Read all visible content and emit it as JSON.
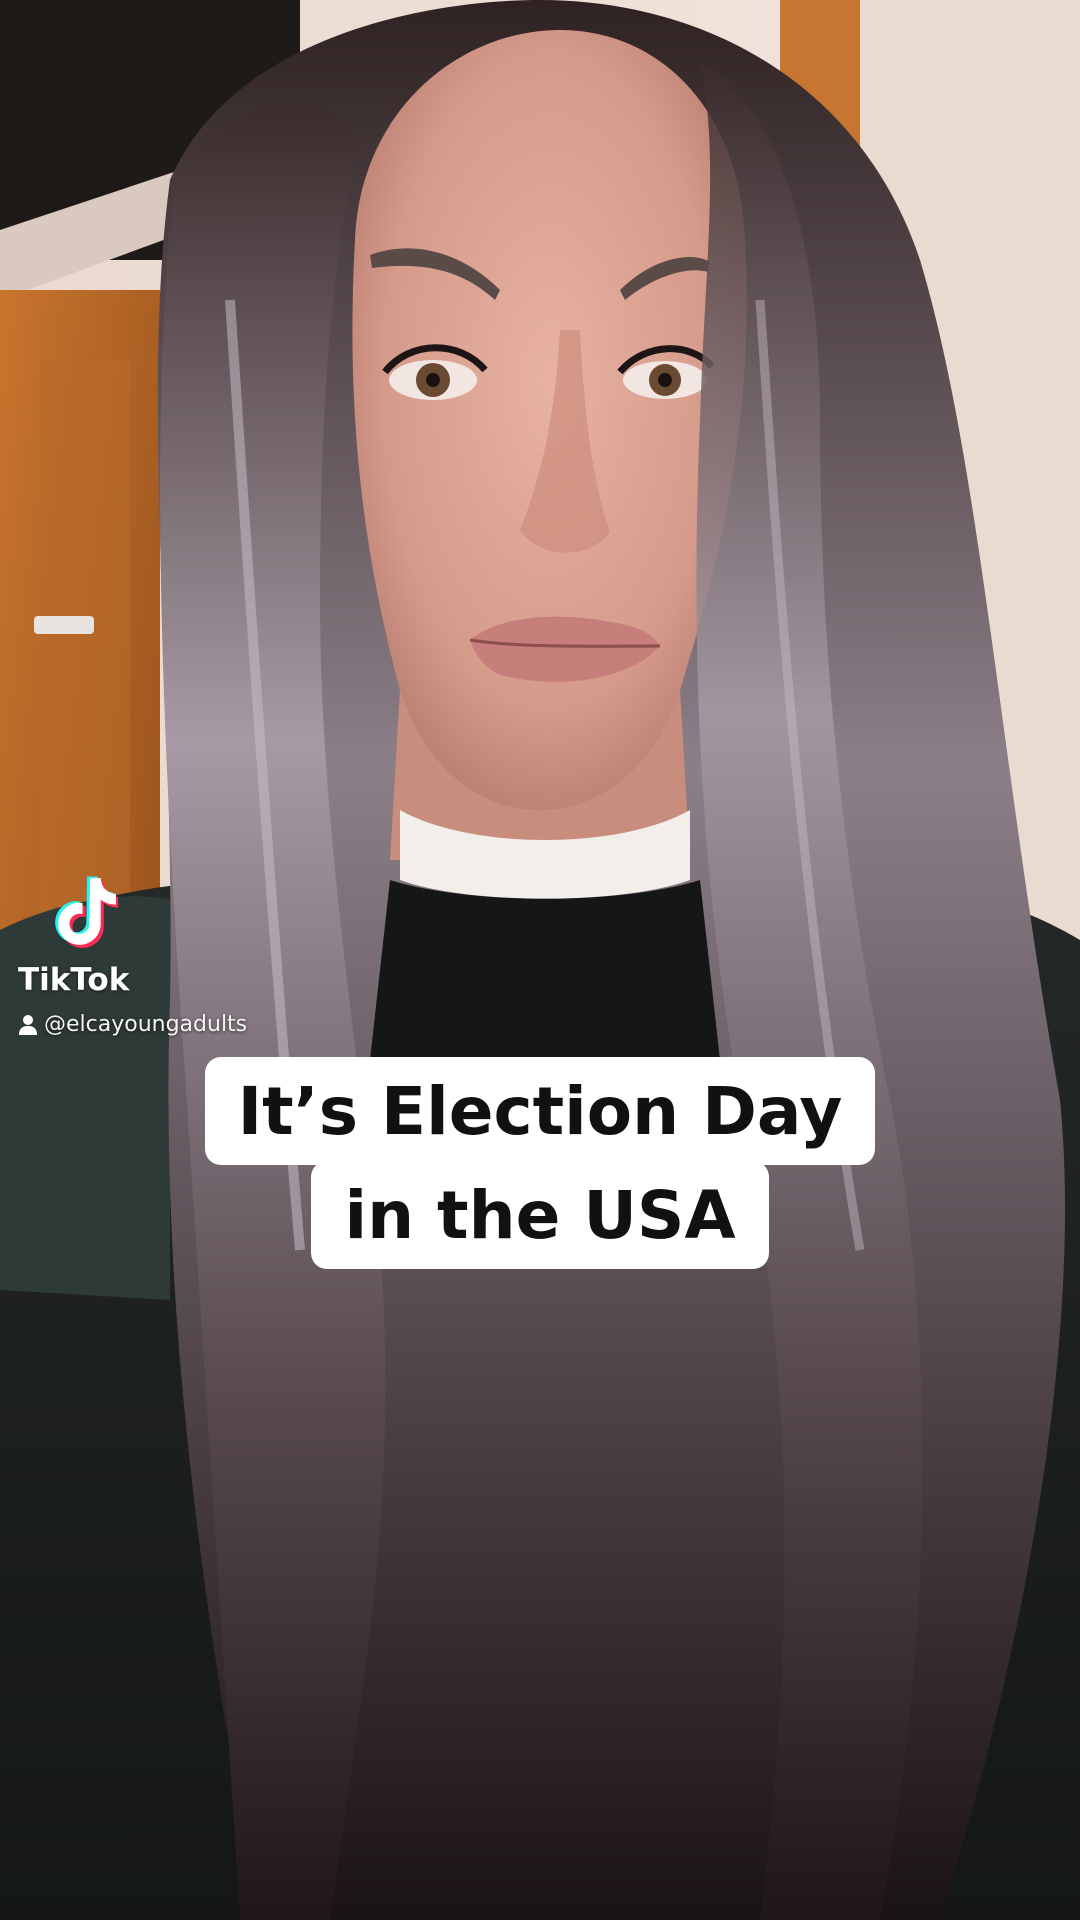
{
  "watermark": {
    "brand": "TikTok",
    "handle": "@elcayoungadults",
    "logo_icon": "tiktok-note-icon",
    "handle_icon": "user-icon",
    "colors": {
      "cyan": "#25F4EE",
      "red": "#FE2C55",
      "white": "#FFFFFF"
    }
  },
  "caption": {
    "line1": "It’s Election Day",
    "line2": "in the USA"
  }
}
